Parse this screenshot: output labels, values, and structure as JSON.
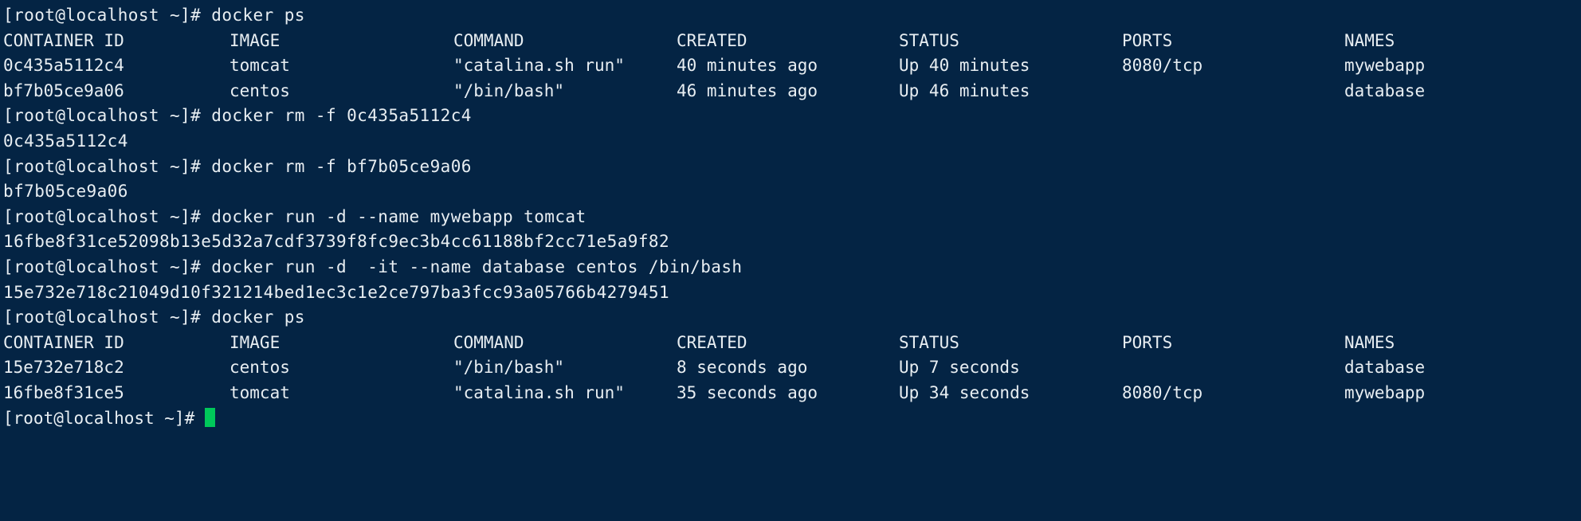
{
  "terminal": {
    "background_color": "#042444",
    "foreground_color": "#e8eef2",
    "cursor_color": "#00c85a",
    "prompt": "[root@localhost ~]# ",
    "columns": {
      "container_id": "CONTAINER ID",
      "image": "IMAGE",
      "command": "COMMAND",
      "created": "CREATED",
      "status": "STATUS",
      "ports": "PORTS",
      "names": "NAMES"
    },
    "lines": {
      "cmd_ps_1": "[root@localhost ~]# docker ps",
      "cmd_rm_1": "[root@localhost ~]# docker rm -f 0c435a5112c4",
      "out_rm_1": "0c435a5112c4",
      "cmd_rm_2": "[root@localhost ~]# docker rm -f bf7b05ce9a06",
      "out_rm_2": "bf7b05ce9a06",
      "cmd_run_1": "[root@localhost ~]# docker run -d --name mywebapp tomcat",
      "out_run_1": "16fbe8f31ce52098b13e5d32a7cdf3739f8fc9ec3b4cc61188bf2cc71e5a9f82",
      "cmd_run_2": "[root@localhost ~]# docker run -d  -it --name database centos /bin/bash",
      "out_run_2": "15e732e718c21049d10f321214bed1ec3c1e2ce797ba3fcc93a05766b4279451",
      "cmd_ps_2": "[root@localhost ~]# docker ps",
      "prompt_final": "[root@localhost ~]# "
    },
    "ps_table_first": [
      {
        "container_id": "0c435a5112c4",
        "image": "tomcat",
        "command": "\"catalina.sh run\"",
        "created": "40 minutes ago",
        "status": "Up 40 minutes",
        "ports": "8080/tcp",
        "names": "mywebapp"
      },
      {
        "container_id": "bf7b05ce9a06",
        "image": "centos",
        "command": "\"/bin/bash\"",
        "created": "46 minutes ago",
        "status": "Up 46 minutes",
        "ports": "",
        "names": "database"
      }
    ],
    "ps_table_second": [
      {
        "container_id": "15e732e718c2",
        "image": "centos",
        "command": "\"/bin/bash\"",
        "created": "8 seconds ago",
        "status": "Up 7 seconds",
        "ports": "",
        "names": "database"
      },
      {
        "container_id": "16fbe8f31ce5",
        "image": "tomcat",
        "command": "\"catalina.sh run\"",
        "created": "35 seconds ago",
        "status": "Up 34 seconds",
        "ports": "8080/tcp",
        "names": "mywebapp"
      }
    ]
  }
}
